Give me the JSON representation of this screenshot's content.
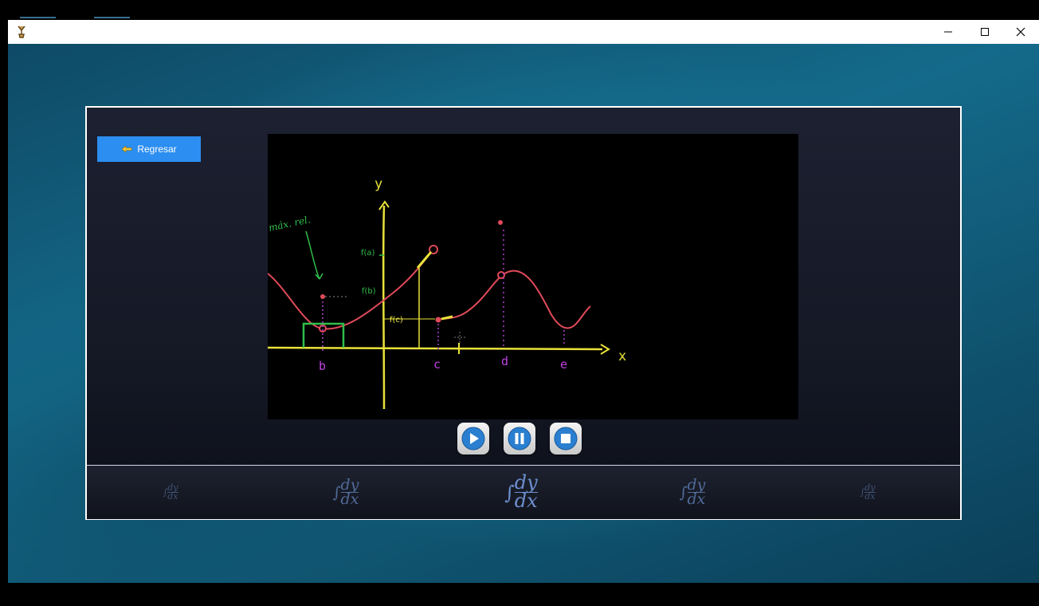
{
  "window": {
    "minimize_glyph": "—",
    "maximize_glyph": "☐",
    "close_glyph": "✕"
  },
  "player": {
    "back_label": "Regresar",
    "controls": [
      "play-icon",
      "pause-icon",
      "stop-icon"
    ]
  },
  "video": {
    "axis_y": "y",
    "axis_x": "x",
    "labels": {
      "max_note": "máx. rel.",
      "fa": "f(a)",
      "fb": "f(b)",
      "fc": "f(c)",
      "tick_b": "b",
      "tick_c": "c",
      "tick_d": "d",
      "tick_e": "e"
    }
  },
  "filmstrip": {
    "items": [
      {
        "num": "dy",
        "den": "dx"
      },
      {
        "num": "dy",
        "den": "dx"
      },
      {
        "num": "dy",
        "den": "dx"
      },
      {
        "num": "dy",
        "den": "dx"
      },
      {
        "num": "dy",
        "den": "dx"
      }
    ]
  },
  "colors": {
    "accent_button": "#2c8ef0",
    "curve": "#e04a5a",
    "axis": "#e8e23a",
    "annotation": "#2fbf4a",
    "tick_label": "#c040e0"
  }
}
